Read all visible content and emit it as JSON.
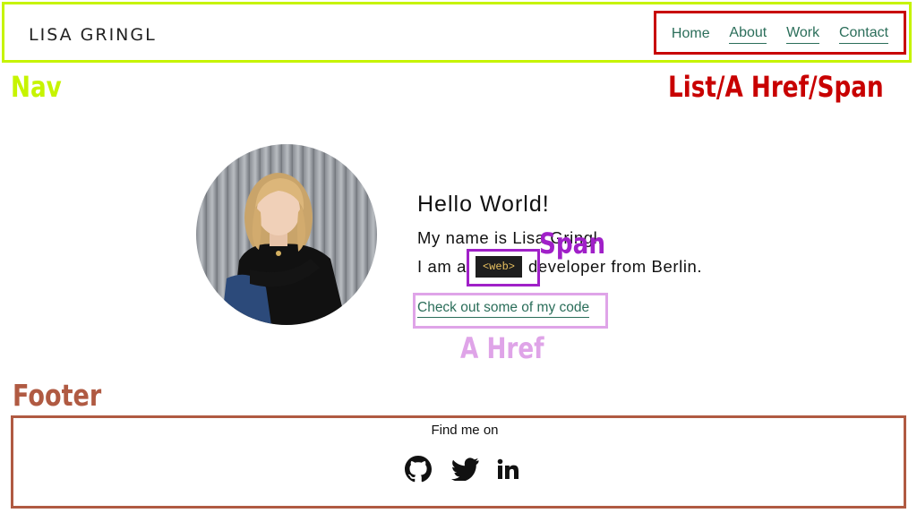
{
  "nav": {
    "brand": "LISA GRINGL",
    "links": [
      {
        "label": "Home"
      },
      {
        "label": "About"
      },
      {
        "label": "Work"
      },
      {
        "label": "Contact"
      }
    ]
  },
  "annotations": {
    "nav": "Nav",
    "list": "List/A Href/Span",
    "span": "Span",
    "a_href": "A Href",
    "footer": "Footer"
  },
  "hero": {
    "greeting": "Hello World!",
    "name_line": "My name is Lisa Gringl.",
    "role_prefix": "I am a",
    "code_tag": "<web>",
    "role_suffix": "developer from Berlin.",
    "cta_link": "Check out some of my code"
  },
  "footer": {
    "find_me": "Find me on",
    "social": [
      {
        "icon": "github-icon"
      },
      {
        "icon": "twitter-icon"
      },
      {
        "icon": "linkedin-icon"
      }
    ]
  },
  "colors": {
    "nav_annotation": "#c6f400",
    "list_annotation": "#c80000",
    "span_annotation": "#a020c8",
    "ahref_annotation": "#dfa4e8",
    "footer_annotation": "#b05a42",
    "link": "#2b6e5a"
  }
}
